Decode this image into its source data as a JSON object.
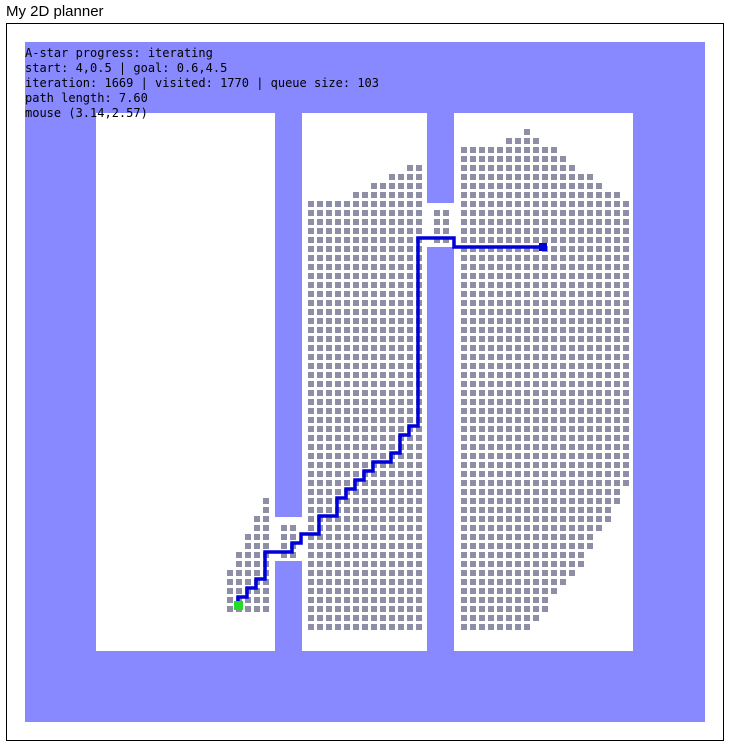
{
  "window": {
    "title": "My 2D planner"
  },
  "status": {
    "progress": "A-star progress: iterating",
    "start_goal": "start: 4,0.5 | goal: 0.6,4.5",
    "counters": "iteration: 1669 | visited: 1770 | queue size: 103",
    "path_length": "path length: 7.60",
    "mouse": "mouse (3.14,2.57)"
  },
  "colors": {
    "obstacle": "#8888ff",
    "free_space": "#ffffff",
    "visited_cell": "#8e8ea6",
    "path": "#0000d8",
    "start_marker": "#22dd22",
    "goal_marker": "#0000d8"
  }
}
